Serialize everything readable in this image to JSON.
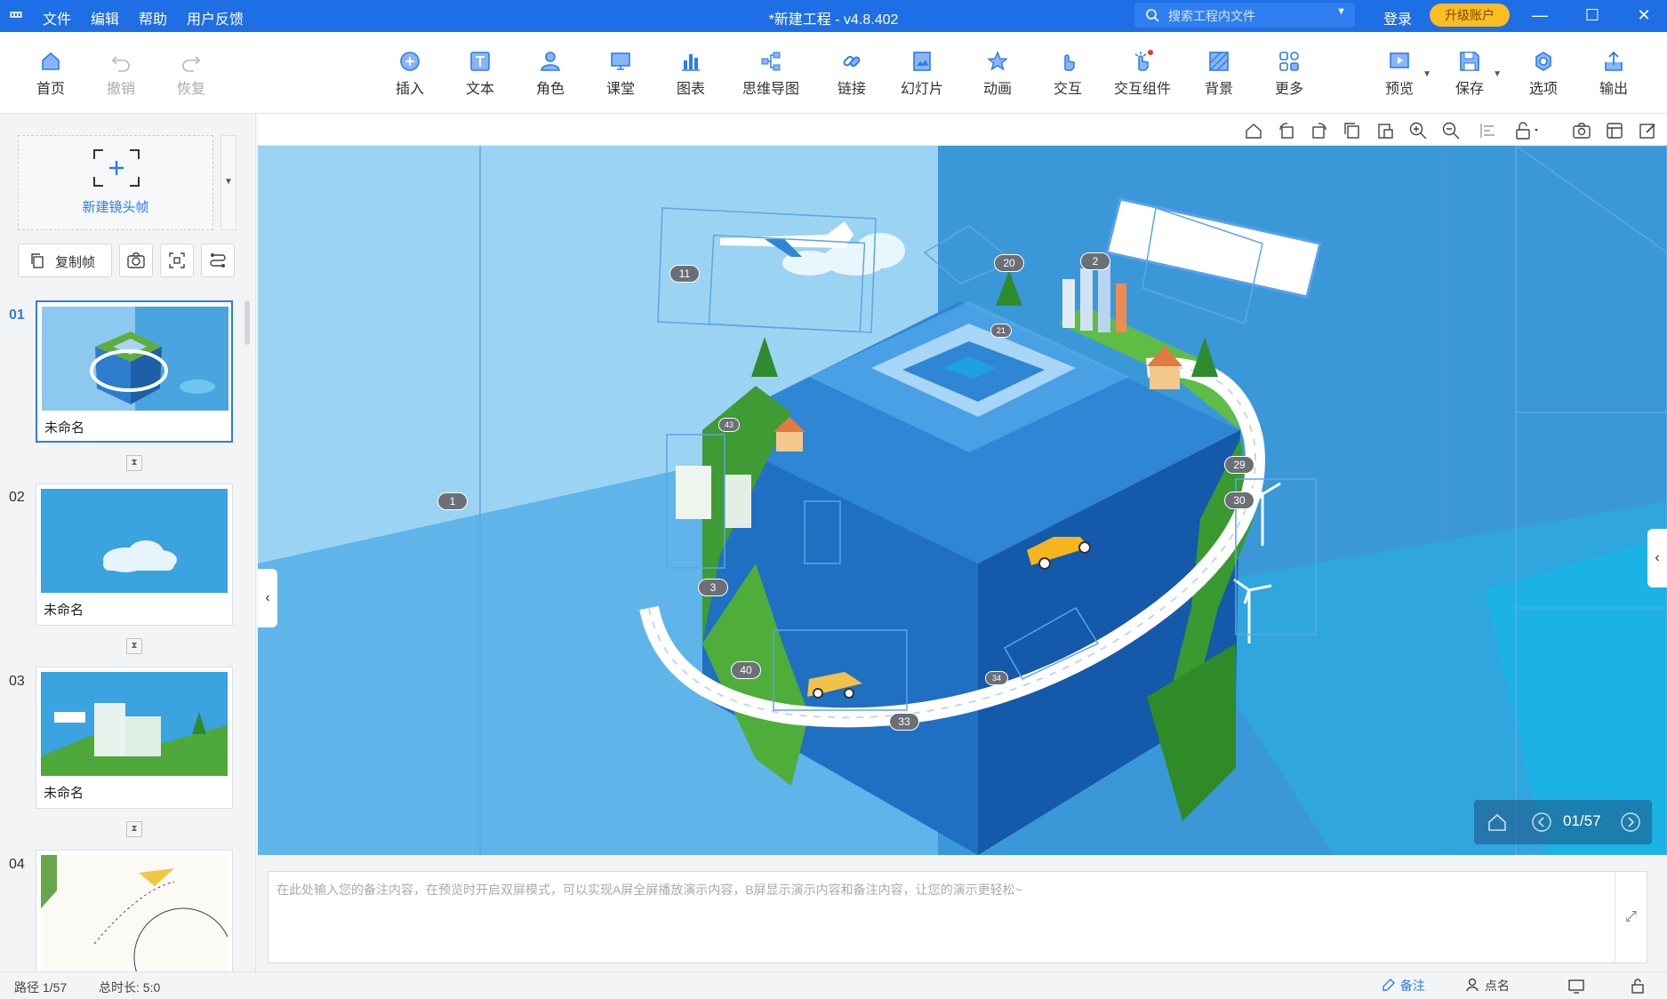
{
  "titlebar": {
    "logo": "罒",
    "menu": [
      "文件",
      "编辑",
      "帮助",
      "用户反馈"
    ],
    "title": "*新建工程 - v4.8.402",
    "search_placeholder": "搜索工程内文件",
    "login": "登录",
    "upgrade": "升级账户",
    "controls": {
      "minimize": "—",
      "maximize": "☐",
      "close": "✕"
    }
  },
  "toolbar": {
    "home": "首页",
    "undo": "撤销",
    "redo": "恢复",
    "insert": "插入",
    "text": "文本",
    "role": "角色",
    "classroom": "课堂",
    "chart": "图表",
    "mindmap": "思维导图",
    "link": "链接",
    "slide": "幻灯片",
    "animation": "动画",
    "interact": "交互",
    "widget": "交互组件",
    "background": "背景",
    "more": "更多",
    "preview": "预览",
    "save": "保存",
    "options": "选项",
    "export": "输出"
  },
  "sidebar": {
    "new_frame": "新建镜头帧",
    "copy_frame": "复制帧",
    "frames": [
      {
        "num": "01",
        "name": "未命名"
      },
      {
        "num": "02",
        "name": "未命名"
      },
      {
        "num": "03",
        "name": "未命名"
      },
      {
        "num": "04",
        "name": ""
      }
    ]
  },
  "canvas": {
    "path_markers": [
      "1",
      "2",
      "3",
      "11",
      "20",
      "21",
      "29",
      "30",
      "33",
      "34",
      "40",
      "43"
    ],
    "page_indicator": "01/57"
  },
  "notes": {
    "placeholder": "在此处输入您的备注内容，在预览时开启双屏模式，可以实现A屏全屏播放演示内容，B屏显示演示内容和备注内容，让您的演示更轻松~"
  },
  "status": {
    "path": "路径 1/57",
    "duration": "总时长: 5:0",
    "notes": "备注",
    "rollcall": "点名"
  },
  "colors": {
    "titlebar": "#1e6ee6",
    "accent": "#2b7de9",
    "upgrade": "#fbbd23",
    "canvas": "#3d9fdc"
  }
}
